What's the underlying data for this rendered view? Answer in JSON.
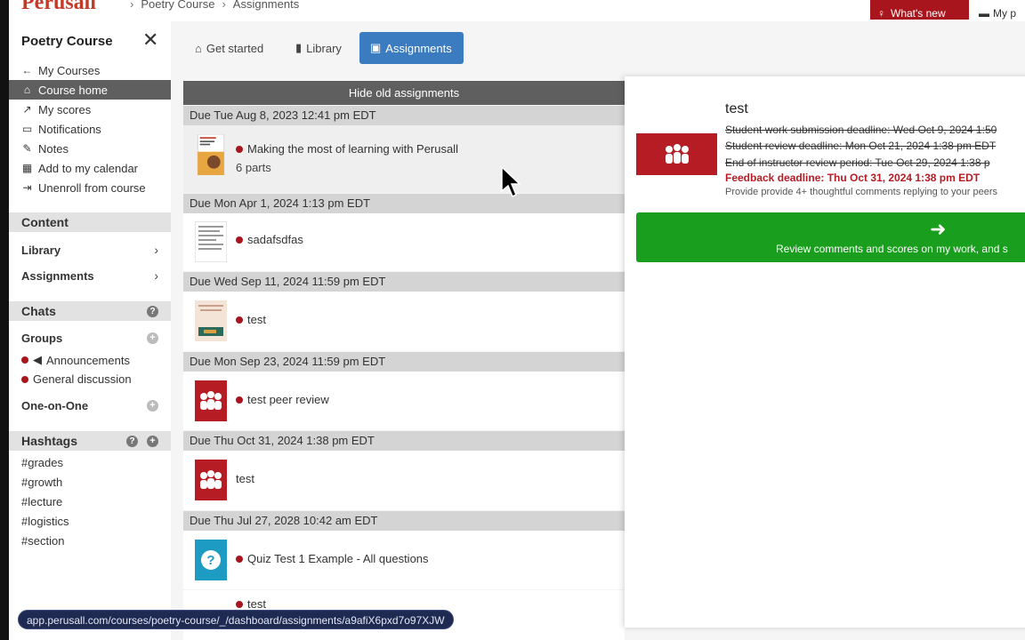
{
  "header": {
    "logo": "Perusall",
    "breadcrumbs": [
      "Poetry Course",
      "Assignments"
    ],
    "whats_new": "What's new",
    "my_button": "My p"
  },
  "sidebar": {
    "title": "Poetry Course",
    "nav": [
      {
        "icon": "arrow-left-icon",
        "glyph": "←",
        "label": "My Courses"
      },
      {
        "icon": "home-icon",
        "glyph": "⌂",
        "label": "Course home"
      },
      {
        "icon": "chart-icon",
        "glyph": "↗",
        "label": "My scores"
      },
      {
        "icon": "inbox-icon",
        "glyph": "▭",
        "label": "Notifications"
      },
      {
        "icon": "pencil-icon",
        "glyph": "✎",
        "label": "Notes"
      },
      {
        "icon": "calendar-icon",
        "glyph": "▦",
        "label": "Add to my calendar"
      },
      {
        "icon": "sign-out-icon",
        "glyph": "⇥",
        "label": "Unenroll from course"
      }
    ],
    "content_head": "Content",
    "library": "Library",
    "assignments": "Assignments",
    "chats_head": "Chats",
    "groups": "Groups",
    "group_items": [
      "Announcements",
      "General discussion"
    ],
    "one_on_one": "One-on-One",
    "hashtags_head": "Hashtags",
    "hashtags": [
      "#grades",
      "#growth",
      "#lecture",
      "#logistics",
      "#section"
    ]
  },
  "tabs": [
    {
      "label": "Get started",
      "glyph": "⌂"
    },
    {
      "label": "Library",
      "glyph": "▮"
    },
    {
      "label": "Assignments",
      "glyph": "▣"
    }
  ],
  "list": {
    "hide_old": "Hide old assignments",
    "groups": [
      {
        "due": "Due Tue Aug 8, 2023 12:41 pm EDT",
        "title": "Making the most of learning with Perusall",
        "sub": "6 parts"
      },
      {
        "due": "Due Mon Apr 1, 2024 1:13 pm EDT",
        "title": "sadafsdfas"
      },
      {
        "due": "Due Wed Sep 11, 2024 11:59 pm EDT",
        "title": "test"
      },
      {
        "due": "Due Mon Sep 23, 2024 11:59 pm EDT",
        "title": "test peer review"
      },
      {
        "due": "Due Thu Oct 31, 2024 1:38 pm EDT",
        "title": "test"
      },
      {
        "due": "Due Thu Jul 27, 2028 10:42 am EDT",
        "title": "Quiz Test 1 Example - All questions"
      },
      {
        "title": "test"
      }
    ]
  },
  "panel": {
    "title": "test",
    "lines": [
      "Student work submission deadline: Wed Oct 9, 2024 1:50",
      "Student review deadline: Mon Oct 21, 2024 1:38 pm EDT",
      "End of instructor review period: Tue Oct 29, 2024 1:38 p",
      "Feedback deadline: Thu Oct 31, 2024 1:38 pm EDT"
    ],
    "note": "Provide provide 4+ thoughtful comments replying to your peers",
    "button_label": "Review comments and scores on my work, and s"
  },
  "status_url": "app.perusall.com/courses/poetry-course/_/dashboard/assignments/a9afiX6pxd7o97XJW",
  "colors": {
    "accent": "#3b7bbf",
    "brand_red": "#b51c24",
    "go_green": "#1a9e1d"
  }
}
